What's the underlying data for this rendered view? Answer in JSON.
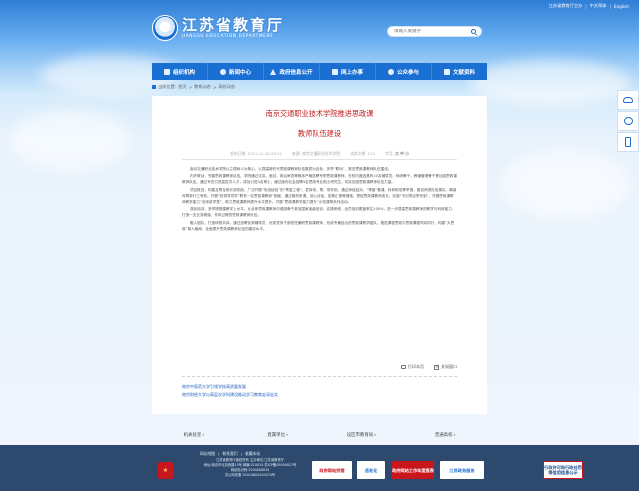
{
  "header": {
    "toplinks": [
      "江苏省教育厅主办",
      "中文简体",
      "English"
    ],
    "logo_cn": "江苏省教育厅",
    "logo_en": "JIANGSU EDUCATION DEPARTMENT",
    "search_placeholder": "请输入关键字"
  },
  "nav": {
    "items": [
      {
        "label": "组织机构",
        "icon": "org-icon"
      },
      {
        "label": "新闻中心",
        "icon": "news-icon"
      },
      {
        "label": "政府信息公开",
        "icon": "gov-info-icon"
      },
      {
        "label": "网上办事",
        "icon": "service-icon"
      },
      {
        "label": "公众参与",
        "icon": "public-icon"
      },
      {
        "label": "文献资料",
        "icon": "docs-icon"
      }
    ]
  },
  "breadcrumb": [
    "当前位置:",
    "首页",
    "教育动态",
    "高校动态"
  ],
  "article": {
    "title_line1": "南京交通职业技术学院推进思政课",
    "title_line2": "教师队伍建设",
    "meta_date": "发布日期: 2021-11-18 09:21",
    "meta_source": "来源: 南京交通职业技术学院",
    "meta_views": "浏览次数: 113",
    "meta_size_label": "字号:",
    "meta_size": "大 中 小",
    "paragraphs": [
      "南京交通职业技术学院以立德树人为核心，以提高新时代思政课教师队伍素质为目标，多举“联动”，推进思政课教师队伍建设。",
      "内外联动，完善思政课教师队伍。学院通过试讲、面试、政治审查等程序严格选聘专职思政课教师，在校内遴选具有10名辅导员、科研骨干、教辅管理骨干等加强思政课教师队伍。通过专任引进高层次人才，成功引进3名博士，通过面向社会招聘4名思政专业硕士研究生，切实加强思政课教师队伍力量。",
      "项目推进，构建互帮互助长效机制。广泛开展“传送经验”的“青蓝工程”，发挥传、帮、带作用。通过师徒结对，“青椒”备课、科研助攻等举措，建设师资队伍梯队，确保传帮带行之有效。开展“校领导导学”联系一名思政课教师”制度，通过随机听课、谈心谈话、定期汇报等措施，督促思政课教师成长。实施“书记项目责任制”，开展思政课教师教学能力“名师讲学堂”，助力思政课教师提升水平提升。开展“思政课教学能力提升”示范课等系列活动。",
      "强化培训，多举措搭建教学上水平。从全体思政课教师中遴选骨干参加国家省级培训，实践研修，全员培训覆盖率达100%，进一步提高思政课教师的教学与科研能力，打造一支业务精湛、作风过硬的思政课教师队伍。",
      "融入团队，打造研修共体。通过选聘优秀辅导员、优秀党务干部担任兼职思政课教师，形成专兼结合的思政课教学团队，推进课程思政与思政课程同向同行，构建“大思政”育人格局，全面提升思政课教师队伍的建设水平。"
    ],
    "print_label": "打印本页",
    "close_label": "关闭窗口",
    "related": [
      "南京中医药大学引领学校高质量发展",
      "南京财经大学以高层次学科建设推动学习教育走深走实"
    ]
  },
  "footer_links": [
    "机关处室",
    "直属单位",
    "设区市教育局",
    "普通高校"
  ],
  "footer": {
    "links": [
      "网站地图",
      "联系我们",
      "收藏本站"
    ],
    "info": [
      "江苏省教育厅版权所有 主办单位:江苏省教育厅",
      "地址:南京市北京西路15号 邮编:210024 苏ICP备05009012号",
      "网站标识码:3200000034",
      "苏公网安备 32010602010070号"
    ],
    "badges": [
      "政府网站找错",
      "适老化",
      "政府网站工作年度报表",
      "江苏政务服务",
      "行政许可和行政处罚等信用信息公示"
    ]
  }
}
